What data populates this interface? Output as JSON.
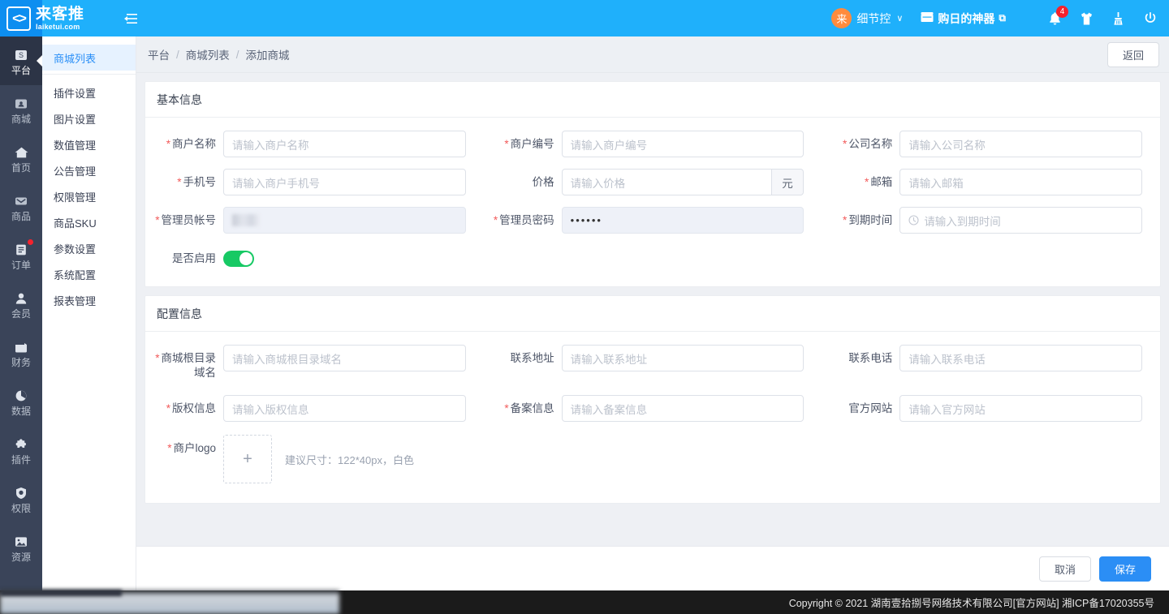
{
  "header": {
    "brand_name": "来客推",
    "brand_url": "laiketui.com",
    "collapse_icon": "menu-collapse-icon",
    "avatar_text": "来",
    "user_name": "细节控",
    "caret": "∨",
    "shop_label": "购日的神器",
    "shop_icon": "shop-icon",
    "external_icon": "⧉",
    "bell_icon": "bell-icon",
    "bell_badge": "4",
    "shirt_icon": "theme-shirt-icon",
    "broom_icon": "clear-cache-broom-icon",
    "power_icon": "logout-power-icon",
    "accent_color": "#1fb0fb"
  },
  "rail": {
    "items": [
      {
        "label": "平台",
        "icon": "platform-icon",
        "glyph": "S",
        "active": true,
        "dot": false
      },
      {
        "label": "商城",
        "icon": "mall-icon",
        "glyph": "☺",
        "active": false,
        "dot": false
      },
      {
        "label": "首页",
        "icon": "home-icon",
        "glyph": "⌂",
        "active": false,
        "dot": false
      },
      {
        "label": "商品",
        "icon": "goods-icon",
        "glyph": "✉",
        "active": false,
        "dot": false
      },
      {
        "label": "订单",
        "icon": "order-icon",
        "glyph": "☰",
        "active": false,
        "dot": true
      },
      {
        "label": "会员",
        "icon": "member-icon",
        "glyph": "♟",
        "active": false,
        "dot": false
      },
      {
        "label": "财务",
        "icon": "finance-icon",
        "glyph": "◧",
        "active": false,
        "dot": false
      },
      {
        "label": "数据",
        "icon": "data-pie-icon",
        "glyph": "◔",
        "active": false,
        "dot": false
      },
      {
        "label": "插件",
        "icon": "plugin-icon",
        "glyph": "✤",
        "active": false,
        "dot": false
      },
      {
        "label": "权限",
        "icon": "permission-shield-icon",
        "glyph": "⛨",
        "active": false,
        "dot": false
      },
      {
        "label": "资源",
        "icon": "resource-image-icon",
        "glyph": "⬚",
        "active": false,
        "dot": false
      }
    ]
  },
  "submenu": {
    "items": [
      {
        "label": "商城列表",
        "active": true
      },
      {
        "label": "插件设置",
        "active": false
      },
      {
        "label": "图片设置",
        "active": false
      },
      {
        "label": "数值管理",
        "active": false
      },
      {
        "label": "公告管理",
        "active": false
      },
      {
        "label": "权限管理",
        "active": false
      },
      {
        "label": "商品SKU",
        "active": false
      },
      {
        "label": "参数设置",
        "active": false
      },
      {
        "label": "系统配置",
        "active": false
      },
      {
        "label": "报表管理",
        "active": false
      }
    ]
  },
  "breadcrumb": {
    "root": "平台",
    "sep1": "/",
    "level2": "商城列表",
    "sep2": "/",
    "current": "添加商城",
    "back_label": "返回"
  },
  "basic": {
    "title": "基本信息",
    "fields": {
      "merchant_name": {
        "label": "商户名称",
        "required": true,
        "placeholder": "请输入商户名称",
        "value": ""
      },
      "merchant_code": {
        "label": "商户编号",
        "required": true,
        "placeholder": "请输入商户编号",
        "value": ""
      },
      "company_name": {
        "label": "公司名称",
        "required": true,
        "placeholder": "请输入公司名称",
        "value": ""
      },
      "phone": {
        "label": "手机号",
        "required": true,
        "placeholder": "请输入商户手机号",
        "value": ""
      },
      "price": {
        "label": "价格",
        "required": false,
        "placeholder": "请输入价格",
        "value": "",
        "unit": "元"
      },
      "email": {
        "label": "邮箱",
        "required": true,
        "placeholder": "请输入邮箱",
        "value": ""
      },
      "admin_account": {
        "label": "管理员帐号",
        "required": true,
        "placeholder": "",
        "value": "",
        "redacted": true
      },
      "admin_password": {
        "label": "管理员密码",
        "required": true,
        "placeholder": "",
        "value": "••••••"
      },
      "expire_time": {
        "label": "到期时间",
        "required": true,
        "placeholder": "请输入到期时间",
        "value": "",
        "icon": "clock-icon"
      },
      "enabled": {
        "label": "是否启用",
        "required": false,
        "state": "on",
        "on_color": "#17c964"
      }
    }
  },
  "config": {
    "title": "配置信息",
    "fields": {
      "root_domain": {
        "label": "商城根目录域名",
        "required": true,
        "placeholder": "请输入商城根目录域名",
        "value": ""
      },
      "contact_address": {
        "label": "联系地址",
        "required": false,
        "placeholder": "请输入联系地址",
        "value": ""
      },
      "contact_phone": {
        "label": "联系电话",
        "required": false,
        "placeholder": "请输入联系电话",
        "value": ""
      },
      "copyright_info": {
        "label": "版权信息",
        "required": true,
        "placeholder": "请输入版权信息",
        "value": ""
      },
      "icp_info": {
        "label": "备案信息",
        "required": true,
        "placeholder": "请输入备案信息",
        "value": ""
      },
      "official_site": {
        "label": "官方网站",
        "required": false,
        "placeholder": "请输入官方网站",
        "value": ""
      },
      "logo": {
        "label": "商户logo",
        "required": true,
        "plus": "+",
        "tip": "建议尺寸：122*40px，白色"
      }
    }
  },
  "footer": {
    "cancel_label": "取消",
    "save_label": "保存",
    "primary_color": "#2b8ef5"
  },
  "bottombar": {
    "copyright": "Copyright © 2021 湖南壹拾捌号网络技术有限公司[官方网站]  湘ICP备17020355号"
  }
}
